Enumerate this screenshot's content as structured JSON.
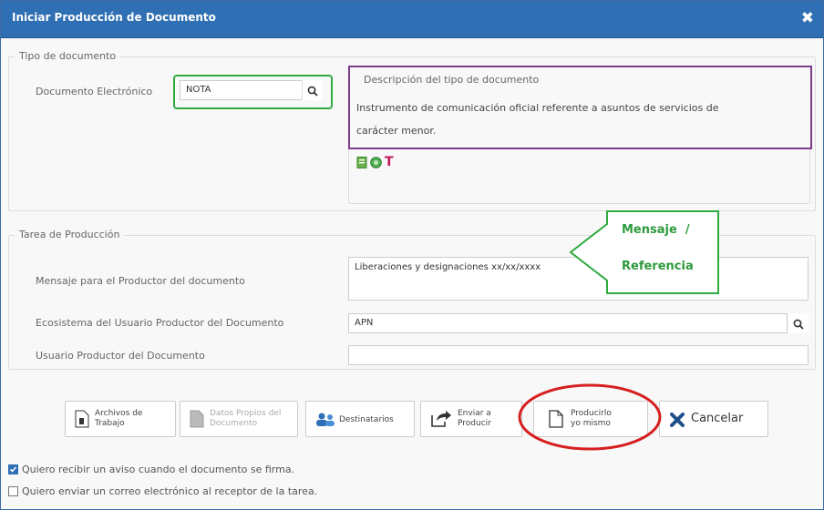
{
  "dialog": {
    "title": "Iniciar Producción de Documento",
    "close": "✖"
  },
  "tipo": {
    "legend": "Tipo de documento",
    "doc_label": "Documento Electrónico",
    "doc_value": "NOTA",
    "desc_legend": "Descripción del tipo de documento",
    "desc_text_1": "Instrumento de comunicación oficial referente a asuntos de servicios de",
    "desc_text_2": "carácter menor.",
    "badge_icons": [
      "document-green-icon",
      "globe-icon",
      "t-red-icon"
    ],
    "badge_t": "T"
  },
  "tarea": {
    "legend": "Tarea de Producción",
    "mensaje_label": "Mensaje para el Productor del documento",
    "mensaje_value": "Liberaciones y designaciones xx/xx/xxxx",
    "ecosistema_label": "Ecosistema del Usuario Productor del Documento",
    "ecosistema_value": "APN",
    "usuario_label": "Usuario Productor del Documento",
    "usuario_value": ""
  },
  "callout": {
    "line1": "Mensaje  /",
    "line2": "Referencia"
  },
  "buttons": {
    "archivos_1": "Archivos de",
    "archivos_2": "Trabajo",
    "datos_1": "Datos Propios del",
    "datos_2": "Documento",
    "destinatarios": "Destinatarios",
    "enviar_1": "Enviar a",
    "enviar_2": "Producir",
    "producirlo_1": "Producirlo",
    "producirlo_2": "yo mismo",
    "cancelar": "Cancelar"
  },
  "options": {
    "aviso": "Quiero recibir un aviso cuando el documento se firma.",
    "aviso_checked": true,
    "correo": "Quiero enviar un correo electrónico al receptor de la tarea.",
    "correo_checked": false
  },
  "colors": {
    "header": "#2f6fb3",
    "green_highlight": "#2eaa3e",
    "purple_highlight": "#7a3c8c",
    "red_circle": "#d61f1f",
    "callout_text": "#2e9a3c"
  }
}
